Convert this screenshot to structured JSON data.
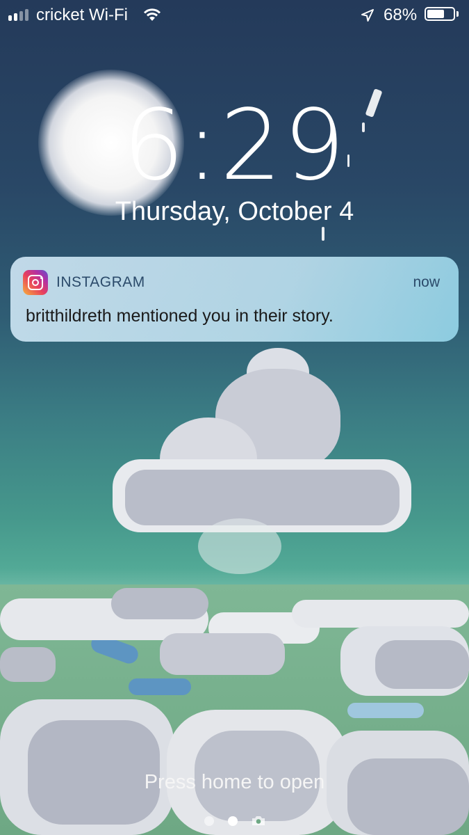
{
  "status_bar": {
    "carrier": "cricket Wi-Fi",
    "battery_percent": "68%",
    "battery_level": 0.68,
    "signal_bars_active": 2,
    "icons": [
      "signal-icon",
      "wifi-icon",
      "location-arrow-icon",
      "battery-icon"
    ]
  },
  "lock_screen": {
    "time": "6:29",
    "date": "Thursday, October 4",
    "hint": "Press home to open"
  },
  "notification": {
    "app_name": "INSTAGRAM",
    "time": "now",
    "message": "britthildreth mentioned you in their story.",
    "icon": "instagram-icon"
  },
  "pager": {
    "pages": 2,
    "active_page": 2,
    "trailing_icon": "camera-icon"
  },
  "colors": {
    "sky_top": "#243a5a",
    "sky_mid": "#3b7d84",
    "notification_bg": "#cde4f2"
  }
}
